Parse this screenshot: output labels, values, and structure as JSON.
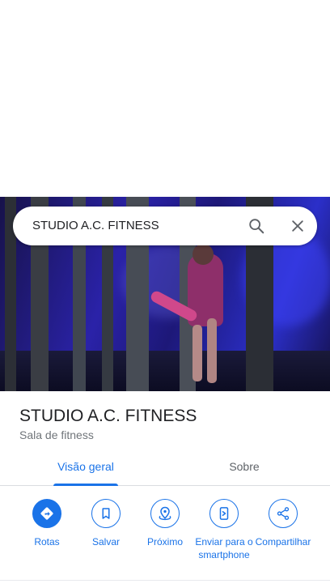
{
  "search": {
    "query": "STUDIO A.C. FITNESS"
  },
  "place": {
    "name": "STUDIO A.C. FITNESS",
    "category": "Sala de fitness"
  },
  "tabs": [
    {
      "label": "Visão geral",
      "selected": true
    },
    {
      "label": "Sobre",
      "selected": false
    }
  ],
  "actions": [
    {
      "label": "Rotas",
      "icon": "directions-icon"
    },
    {
      "label": "Salvar",
      "icon": "bookmark-icon"
    },
    {
      "label": "Próximo",
      "icon": "nearby-icon"
    },
    {
      "label": "Enviar para o smartphone",
      "icon": "send-to-phone-icon"
    },
    {
      "label": "Compartilhar",
      "icon": "share-icon"
    }
  ],
  "colors": {
    "accent": "#1a73e8",
    "text_primary": "#202124",
    "text_secondary": "#70757a"
  }
}
